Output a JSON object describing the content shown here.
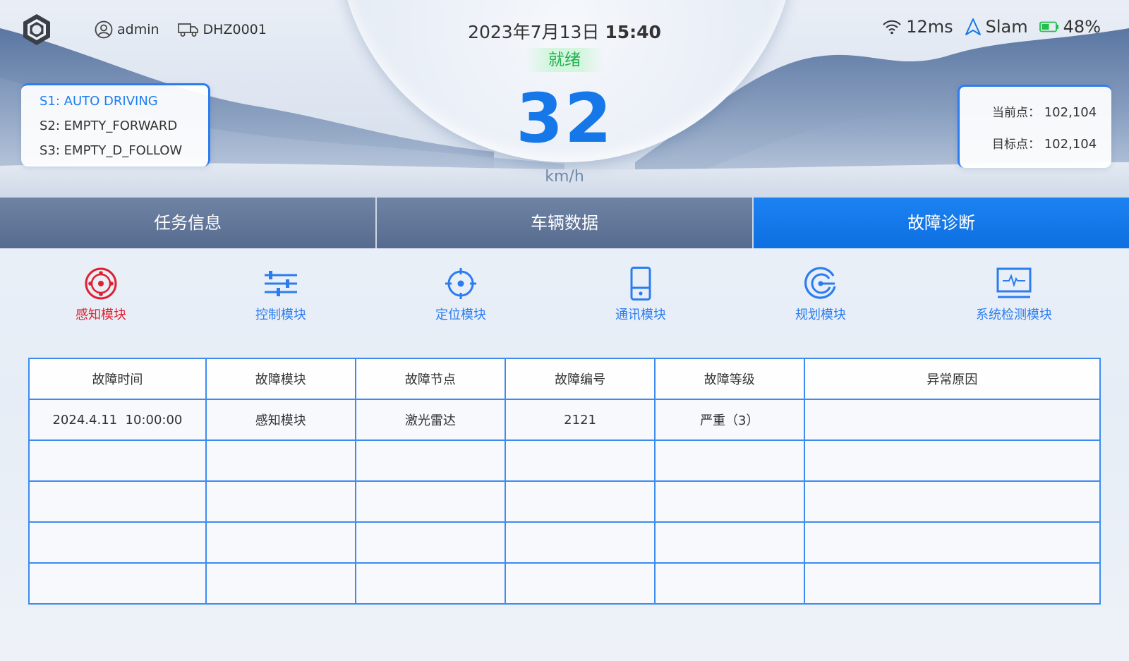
{
  "header": {
    "user": "admin",
    "vehicle_id": "DHZ0001",
    "date": "2023年7月13日",
    "time": "15:40",
    "status": "就绪",
    "speed": "32",
    "speed_unit": "km/h",
    "latency": "12ms",
    "nav_mode": "Slam",
    "battery": "48%"
  },
  "steps": [
    {
      "label": "S1: AUTO DRIVING",
      "active": true
    },
    {
      "label": "S2: EMPTY_FORWARD",
      "active": false
    },
    {
      "label": "S3: EMPTY_D_FOLLOW",
      "active": false
    }
  ],
  "points": {
    "current_label": "当前点：",
    "current_value": "102,104",
    "target_label": "目标点：",
    "target_value": "102,104"
  },
  "tabs": [
    {
      "label": "任务信息"
    },
    {
      "label": "车辆数据"
    },
    {
      "label": "故障诊断"
    }
  ],
  "active_tab": 2,
  "modules": [
    {
      "label": "感知模块",
      "icon": "perception-icon"
    },
    {
      "label": "控制模块",
      "icon": "sliders-icon"
    },
    {
      "label": "定位模块",
      "icon": "crosshair-icon"
    },
    {
      "label": "通讯模块",
      "icon": "phone-icon"
    },
    {
      "label": "规划模块",
      "icon": "planning-icon"
    },
    {
      "label": "系统检测模块",
      "icon": "monitor-pulse-icon"
    }
  ],
  "colors": {
    "accent": "#1677e8",
    "active_module": "#e02030",
    "ready": "#22b050",
    "battery": "#1fbf4a"
  },
  "table": {
    "headers": [
      "故障时间",
      "故障模块",
      "故障节点",
      "故障编号",
      "故障等级",
      "异常原因"
    ],
    "rows": [
      [
        "2024.4.11  10:00:00",
        "感知模块",
        "激光雷达",
        "2121",
        "严重（3）",
        ""
      ],
      [
        "",
        "",
        "",
        "",
        "",
        ""
      ],
      [
        "",
        "",
        "",
        "",
        "",
        ""
      ],
      [
        "",
        "",
        "",
        "",
        "",
        ""
      ],
      [
        "",
        "",
        "",
        "",
        "",
        ""
      ]
    ]
  }
}
